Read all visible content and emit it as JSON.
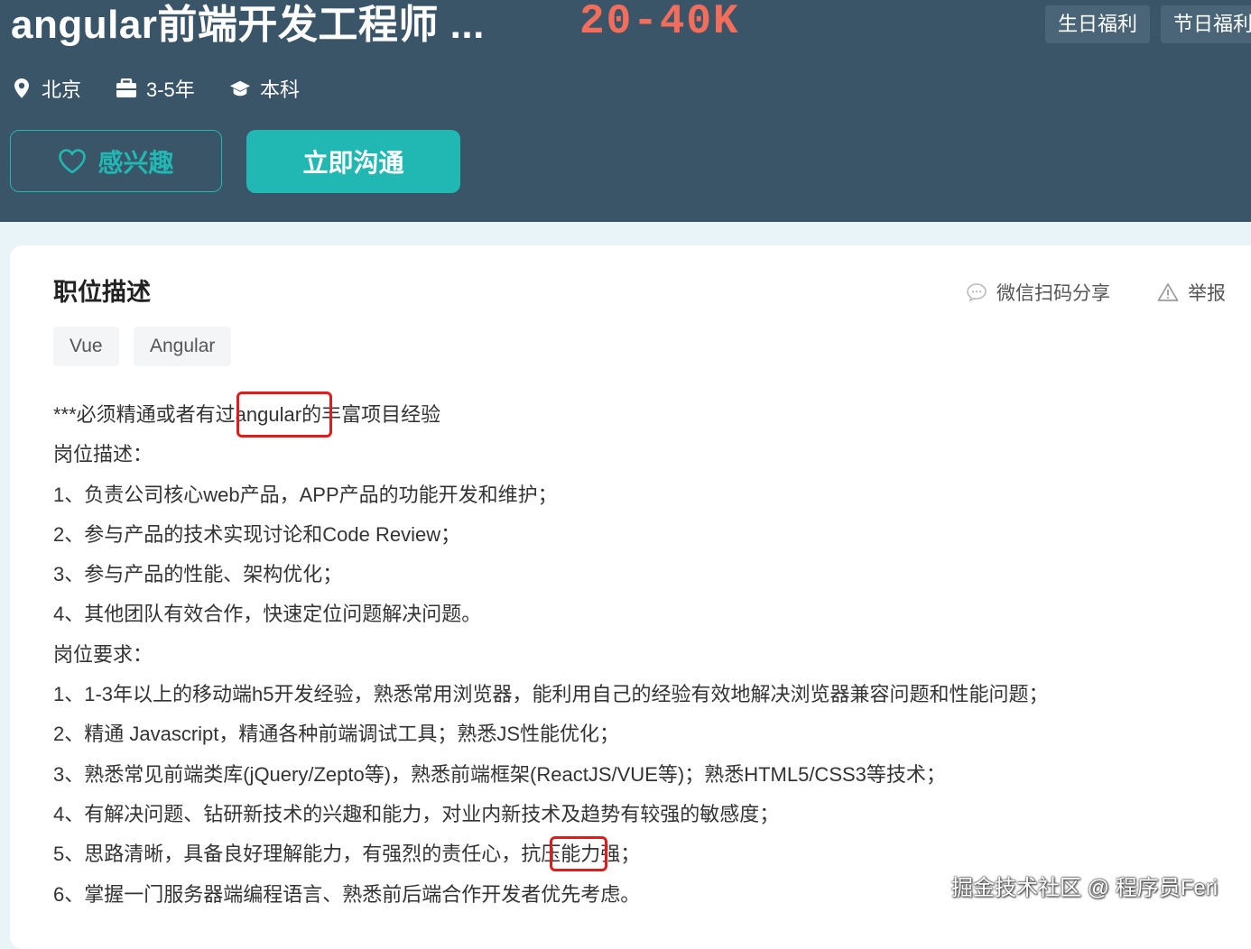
{
  "header": {
    "title": "angular前端开发工程师 ...",
    "salary": "20-40K",
    "welfare": [
      "生日福利",
      "节日福利"
    ],
    "meta": {
      "location": "北京",
      "experience": "3-5年",
      "education": "本科"
    },
    "icons": {
      "location": "location-pin-icon",
      "experience": "briefcase-icon",
      "education": "graduation-cap-icon"
    }
  },
  "actions": {
    "interest_label": "感兴趣",
    "chat_label": "立即沟通",
    "interest_icon": "heart-icon"
  },
  "description": {
    "section_title": "职位描述",
    "share_label": "微信扫码分享",
    "report_label": "举报",
    "tags": [
      "Vue",
      "Angular"
    ],
    "lines": [
      "***必须精通或者有过angular的丰富项目经验",
      "岗位描述：",
      "1、负责公司核心web产品，APP产品的功能开发和维护；",
      "2、参与产品的技术实现讨论和Code Review；",
      "3、参与产品的性能、架构优化；",
      "4、其他团队有效合作，快速定位问题解决问题。",
      "岗位要求：",
      "1、1-3年以上的移动端h5开发经验，熟悉常用浏览器，能利用自己的经验有效地解决浏览器兼容问题和性能问题；",
      "2、精通 Javascript，精通各种前端调试工具；熟悉JS性能优化；",
      "3、熟悉常见前端类库(jQuery/Zepto等)，熟悉前端框架(ReactJS/VUE等)；熟悉HTML5/CSS3等技术；",
      "4、有解决问题、钻研新技术的兴趣和能力，对业内新技术及趋势有较强的敏感度；",
      "5、思路清晰，具备良好理解能力，有强烈的责任心，抗压能力强；",
      "6、掌握一门服务器端编程语言、熟悉前后端合作开发者优先考虑。"
    ]
  },
  "watermark": "掘金技术社区 @ 程序员Feri",
  "colors": {
    "header_bg": "#3a5568",
    "accent": "#21b7b3",
    "salary": "#f26d5b",
    "annotation": "#e01b1b"
  }
}
